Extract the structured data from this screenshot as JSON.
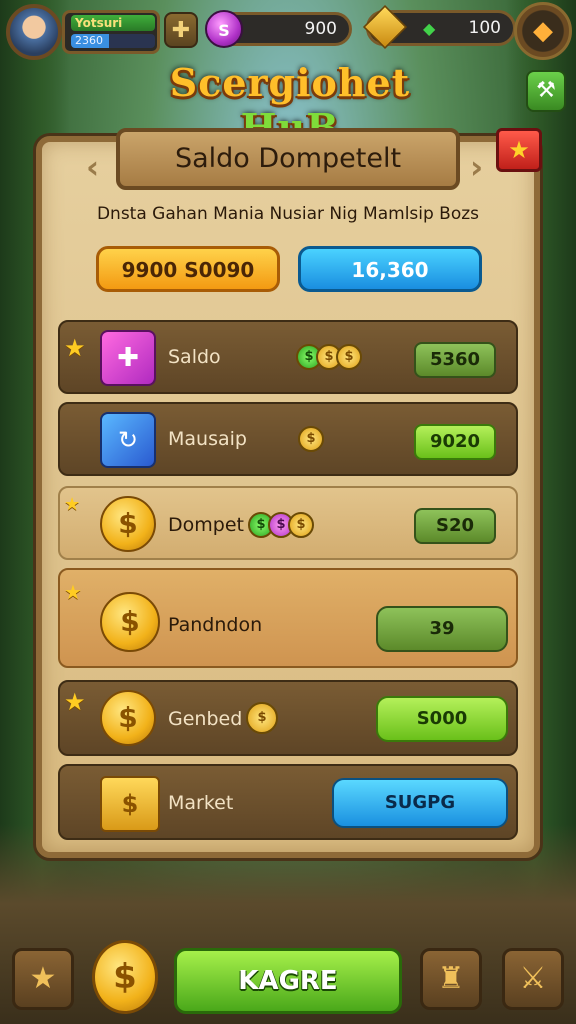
{
  "hud": {
    "xp_label": "Yotsuri",
    "level_value": "2360",
    "gems": "900",
    "gold": "100"
  },
  "title": {
    "main": "Scergiohet",
    "accent": "HuB"
  },
  "panel": {
    "header": "Saldo Dompetelt",
    "subtitle": "Dnsta Gahan Mania Nusiar Nig Mamlsip Bozs",
    "balance_left": "9900 S0090",
    "balance_right": "16,360"
  },
  "rows": [
    {
      "label": "Saldo",
      "value": "5360"
    },
    {
      "label": "Mausaip",
      "value": "9020"
    },
    {
      "label": "Dompet",
      "value": "S20"
    },
    {
      "label": "Pandndon",
      "value": "39"
    },
    {
      "label": "Genbed",
      "value": "S000"
    },
    {
      "label": "Market",
      "value": "SUGPG"
    }
  ],
  "nav": {
    "main_button": "KAGRE"
  },
  "icons": {
    "avatar": "avatar",
    "gem": "gem-icon",
    "gold": "gold-cube-icon",
    "shield": "shield-icon"
  },
  "colors": {
    "title_gold": "#ffbf2a",
    "title_green": "#7fdc3a",
    "panel_bg": "#e6cf9e",
    "accent_green": "#6ac01a",
    "accent_blue": "#1a90e0",
    "accent_orange": "#f39a12"
  }
}
